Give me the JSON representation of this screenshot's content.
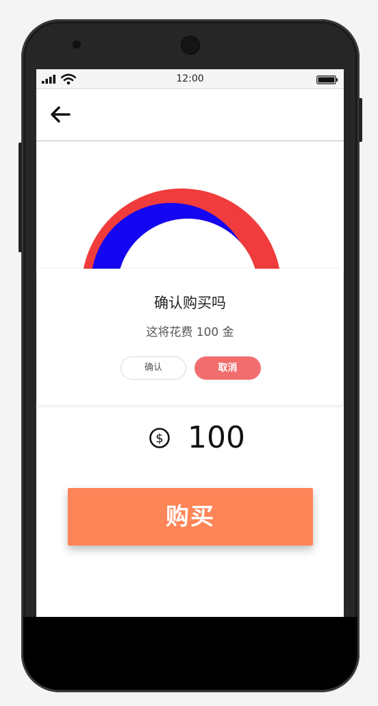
{
  "status_bar": {
    "time": "12:00"
  },
  "header": {
    "back_icon": "arrow-left-icon"
  },
  "progress": {
    "colors": {
      "primary": "#1406f0",
      "secondary": "#f03c3c"
    }
  },
  "dialog": {
    "title": "确认购买吗",
    "message": "这将花费 100 金",
    "confirm_label": "确认",
    "cancel_label": "取消"
  },
  "price": {
    "icon": "dollar-coin-icon",
    "value": "100"
  },
  "buy_button": {
    "label": "购买",
    "color": "#fe8557"
  },
  "colors": {
    "cancel_button": "#f06e6e"
  }
}
